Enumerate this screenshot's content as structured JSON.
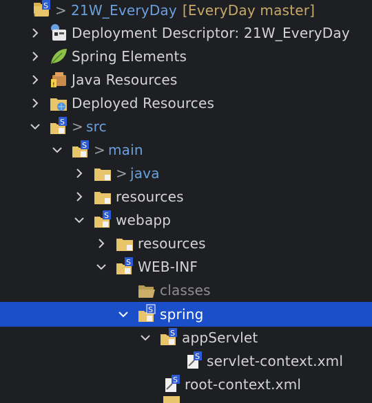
{
  "project": {
    "prefix": ">",
    "name": "21W_EveryDay",
    "git_status": "[EveryDay master]"
  },
  "items": [
    {
      "label": "Deployment Descriptor: 21W_EveryDay",
      "icon": "deployment-descriptor-icon"
    },
    {
      "label": "Spring Elements",
      "icon": "spring-leaf-icon"
    },
    {
      "label": "Java Resources",
      "icon": "java-resources-icon"
    },
    {
      "label": "Deployed Resources",
      "icon": "deployed-resources-icon"
    },
    {
      "prefix": ">",
      "label": "src",
      "icon": "folder-spring-icon"
    },
    {
      "prefix": ">",
      "label": "main",
      "icon": "folder-spring-icon"
    },
    {
      "prefix": ">",
      "label": "java",
      "icon": "folder-icon"
    },
    {
      "label": "resources",
      "icon": "folder-icon"
    },
    {
      "label": "webapp",
      "icon": "folder-spring-icon"
    },
    {
      "label": "resources",
      "icon": "folder-icon"
    },
    {
      "label": "WEB-INF",
      "icon": "folder-spring-icon"
    },
    {
      "label": "classes",
      "icon": "folder-open-icon"
    },
    {
      "label": "spring",
      "icon": "folder-spring-icon",
      "selected": true
    },
    {
      "label": "appServlet",
      "icon": "folder-spring-icon"
    },
    {
      "label": "servlet-context.xml",
      "icon": "spring-xml-file-icon"
    },
    {
      "label": "root-context.xml",
      "icon": "spring-xml-file-icon"
    }
  ],
  "colors": {
    "background": "#1e1f22",
    "selection": "#1b4fc9",
    "text": "#d4d4d4",
    "git_status": "#c7a96a"
  }
}
